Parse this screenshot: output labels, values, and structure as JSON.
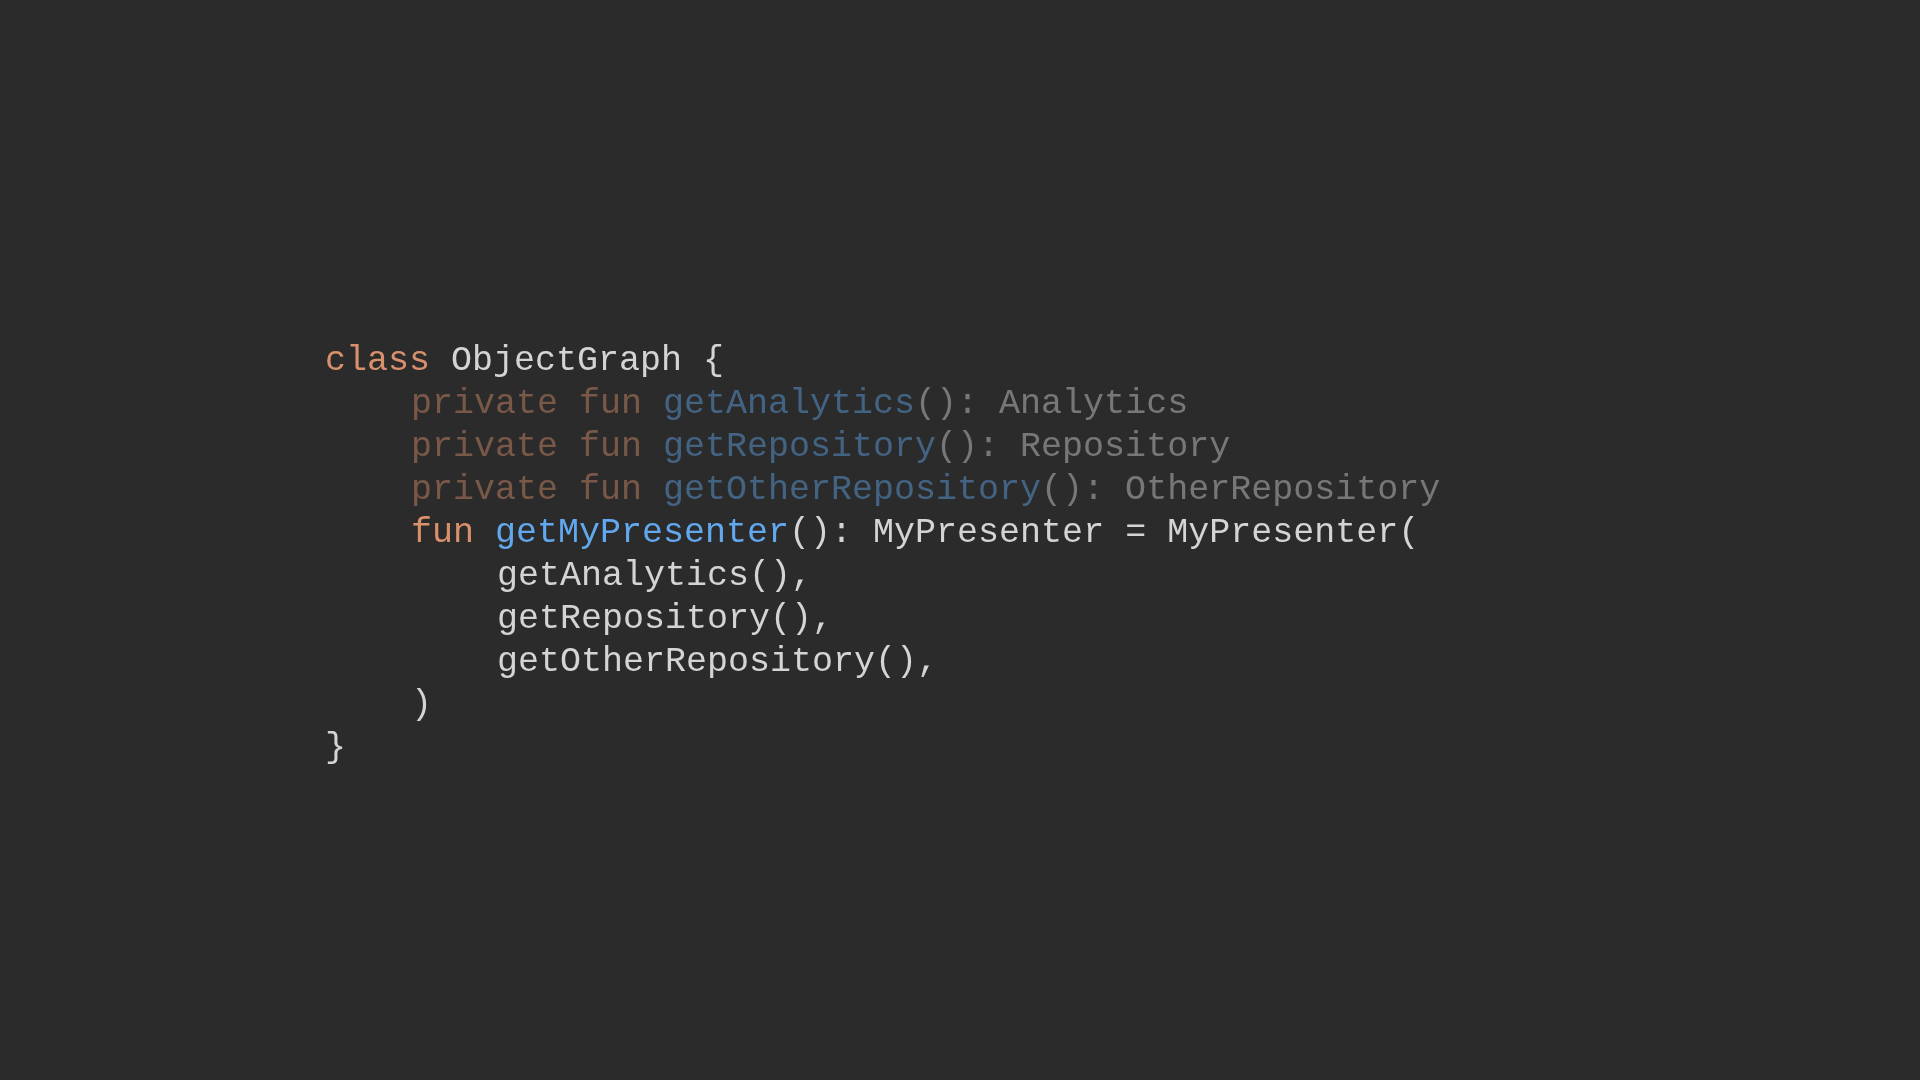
{
  "code": {
    "lines": [
      {
        "dimmed": false,
        "tokens": [
          {
            "kind": "keyword",
            "text": "class"
          },
          {
            "kind": "plain",
            "text": "ObjectGraph {"
          }
        ],
        "children": [
          {
            "dimmed": true,
            "tokens": [
              {
                "kind": "keyword",
                "text": "private fun"
              },
              {
                "kind": "function",
                "text": "getAnalytics"
              },
              {
                "kind": "plain",
                "text": "(): Analytics"
              }
            ]
          },
          {
            "dimmed": true,
            "tokens": [
              {
                "kind": "keyword",
                "text": "private fun"
              },
              {
                "kind": "function",
                "text": "getRepository"
              },
              {
                "kind": "plain",
                "text": "(): Repository"
              }
            ]
          },
          {
            "dimmed": true,
            "tokens": [
              {
                "kind": "keyword",
                "text": "private fun"
              },
              {
                "kind": "function",
                "text": "getOtherRepository"
              },
              {
                "kind": "plain",
                "text": "(): OtherRepository"
              }
            ]
          },
          {
            "dimmed": false,
            "tokens": [
              {
                "kind": "keyword",
                "text": "fun"
              },
              {
                "kind": "function",
                "text": "getMyPresenter"
              },
              {
                "kind": "plain",
                "text": "(): MyPresenter = MyPresenter("
              }
            ],
            "children": [
              {
                "dimmed": false,
                "tokens": [
                  {
                    "kind": "plain",
                    "text": "getAnalytics(),"
                  }
                ]
              },
              {
                "dimmed": false,
                "tokens": [
                  {
                    "kind": "plain",
                    "text": "getRepository(),"
                  }
                ]
              },
              {
                "dimmed": false,
                "tokens": [
                  {
                    "kind": "plain",
                    "text": "getOtherRepository(),"
                  }
                ]
              }
            ]
          },
          {
            "dimmed": false,
            "tokens": [
              {
                "kind": "plain",
                "text": ")"
              }
            ]
          }
        ]
      },
      {
        "dimmed": false,
        "tokens": [
          {
            "kind": "plain",
            "text": "}"
          }
        ]
      }
    ]
  }
}
